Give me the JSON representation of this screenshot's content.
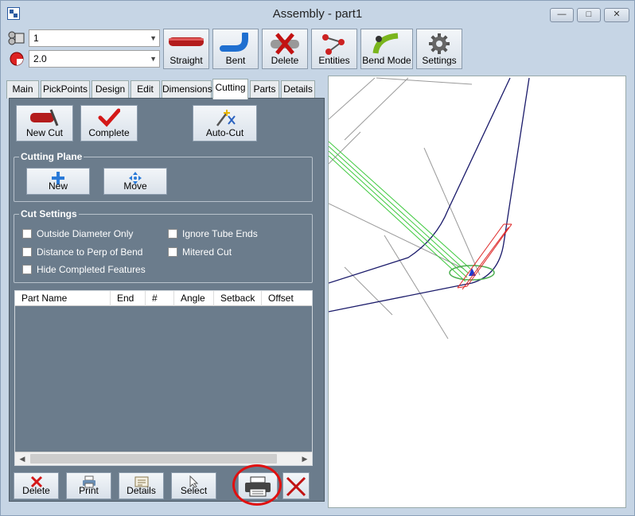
{
  "window": {
    "title": "Assembly - part1"
  },
  "toolbar": {
    "combo1_value": "1",
    "combo2_value": "2.0",
    "buttons": [
      {
        "label": "Straight",
        "icon": "straight-tube-icon"
      },
      {
        "label": "Bent",
        "icon": "bent-tube-icon"
      },
      {
        "label": "Delete",
        "icon": "delete-tube-icon"
      },
      {
        "label": "Entities",
        "icon": "entities-icon"
      },
      {
        "label": "Bend Mode",
        "icon": "bend-mode-icon"
      },
      {
        "label": "Settings",
        "icon": "gear-icon"
      }
    ]
  },
  "tabs": [
    "Main",
    "PickPoints",
    "Design",
    "Edit",
    "Dimensions",
    "Cutting",
    "Parts",
    "Details"
  ],
  "active_tab": "Cutting",
  "cutting": {
    "new_cut_label": "New Cut",
    "complete_label": "Complete",
    "auto_cut_label": "Auto-Cut",
    "cutting_plane": {
      "title": "Cutting Plane",
      "new_label": "New",
      "move_label": "Move"
    },
    "cut_settings": {
      "title": "Cut Settings",
      "options": [
        {
          "label": "Outside Diameter Only",
          "checked": false
        },
        {
          "label": "Ignore Tube Ends",
          "checked": false
        },
        {
          "label": "Distance to Perp of Bend",
          "checked": false
        },
        {
          "label": "Mitered Cut",
          "checked": false
        },
        {
          "label": "Hide Completed Features",
          "checked": false
        }
      ]
    },
    "table": {
      "columns": [
        "Part Name",
        "End",
        "#",
        "Angle",
        "Setback",
        "Offset"
      ],
      "rows": []
    },
    "bottom_buttons": {
      "delete": "Delete",
      "print": "Print",
      "details": "Details",
      "select": "Select"
    }
  },
  "colors": {
    "panel_bg": "#6b7c8c",
    "window_bg": "#c6d5e5",
    "annotation_red": "#e01010",
    "tube_green": "#3cc83c",
    "path_navy": "#1a1a6a"
  }
}
